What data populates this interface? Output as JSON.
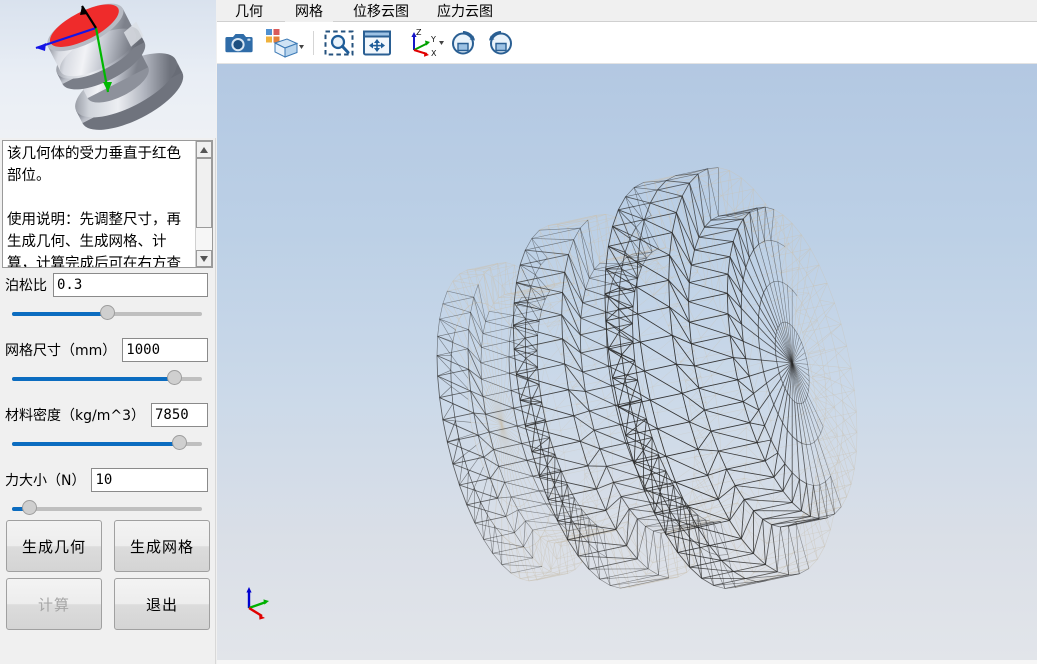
{
  "sidebar": {
    "preview": {
      "name": "geometry-preview-image",
      "highlight_color": "#ef2b2b",
      "body_color": "#c6c9d2",
      "axis_x_color": "#1414e6",
      "axis_y_color": "#00b800",
      "axis_z_color": "#000000"
    },
    "description": {
      "line1": "该几何体的受力垂直于红色部位。",
      "line2": "",
      "line3": "使用说明：先调整尺寸，再生成几何、生成网格、计算，计算完成后可在右方查",
      "full_text": "该几何体的受力垂直于红色部位。\n\n使用说明：先调整尺寸，再生成几何、生成网格、计算，计算完成后可在右方查"
    },
    "params": [
      {
        "label": "泊松比",
        "value": "0.3",
        "slider_percent": 50,
        "input_name": "poisson-ratio-input",
        "slider_name": "poisson-ratio-slider"
      },
      {
        "label": "网格尺寸（mm）",
        "value": "1000",
        "slider_percent": 85,
        "input_name": "mesh-size-input",
        "slider_name": "mesh-size-slider"
      },
      {
        "label": "材料密度（kg/m^3）",
        "value": "7850",
        "slider_percent": 88,
        "input_name": "material-density-input",
        "slider_name": "material-density-slider"
      },
      {
        "label": "力大小（N）",
        "value": "10",
        "slider_percent": 9,
        "input_name": "force-magnitude-input",
        "slider_name": "force-magnitude-slider"
      }
    ],
    "buttons": [
      {
        "label": "生成几何",
        "name": "generate-geometry-button",
        "enabled": true
      },
      {
        "label": "生成网格",
        "name": "generate-mesh-button",
        "enabled": true
      },
      {
        "label": "计算",
        "name": "calculate-button",
        "enabled": false
      },
      {
        "label": "退出",
        "name": "exit-button",
        "enabled": true
      }
    ],
    "slider_colors": {
      "fill": "#0b6cc0",
      "track": "#bfbfbf",
      "thumb": "#cfcfcf"
    }
  },
  "tabs": [
    {
      "label": "几何",
      "name": "tab-geometry",
      "active": false
    },
    {
      "label": "网格",
      "name": "tab-mesh",
      "active": true
    },
    {
      "label": "位移云图",
      "name": "tab-displacement-contour",
      "active": false
    },
    {
      "label": "应力云图",
      "name": "tab-stress-contour",
      "active": false
    }
  ],
  "toolbar": [
    {
      "name": "screenshot-icon",
      "title": "截图"
    },
    {
      "name": "view-cube-icon",
      "title": "视图",
      "has_dropdown": true
    },
    {
      "name": "zoom-box-icon",
      "title": "框选缩放"
    },
    {
      "name": "fit-view-icon",
      "title": "适应窗口"
    },
    {
      "name": "axis-triad-icon",
      "title": "坐标轴",
      "has_dropdown": true
    },
    {
      "name": "rotate-cw-icon",
      "title": "顺时针旋转"
    },
    {
      "name": "rotate-ccw-icon",
      "title": "逆时针旋转"
    }
  ],
  "viewport": {
    "name": "mesh-viewport",
    "background_top": "#b3c8e2",
    "background_bottom": "#e2e5ea",
    "mesh_edge_color": "#2a2a2a",
    "mesh_far_color": "#c9c2b4",
    "axes": {
      "x_label": "X",
      "y_label": "Y",
      "z_label": "Z",
      "x_color": "#e00000",
      "y_color": "#00b000",
      "z_color": "#0000d0"
    }
  }
}
